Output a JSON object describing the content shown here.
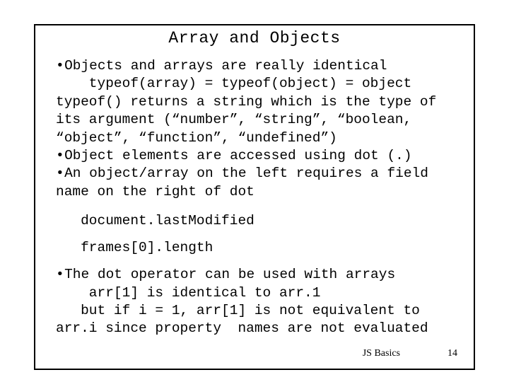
{
  "slide": {
    "title": "Array and Objects",
    "background_color": "#ffffff",
    "text_color": "#000000",
    "border_color": "#000000",
    "body": [
      {
        "kind": "bullet",
        "bullet": "•",
        "text": "Objects and arrays are really identical"
      },
      {
        "kind": "indent",
        "text": "    typeof(array) = typeof(object) = object"
      },
      {
        "kind": "plain",
        "text": "typeof() returns a string which is the type of"
      },
      {
        "kind": "plain",
        "text": "its argument (“number”, “string”, “boolean,"
      },
      {
        "kind": "plain",
        "text": "“object”, “function”, “undefined”)"
      },
      {
        "kind": "bullet",
        "bullet": "•",
        "text": "Object elements are accessed using dot (.)"
      },
      {
        "kind": "bullet",
        "bullet": "•",
        "text": "An object/array on the left requires a field"
      },
      {
        "kind": "plain",
        "text": "name on the right of dot"
      }
    ],
    "examples": [
      {
        "text": "   document.lastModified"
      },
      {
        "text": "   frames[0].length"
      }
    ],
    "body_after": [
      {
        "kind": "bullet",
        "bullet": "•",
        "text": "The dot operator can be used with arrays"
      },
      {
        "kind": "indent",
        "text": "    arr[1] is identical to arr.1"
      },
      {
        "kind": "indent",
        "text": "   but if i = 1, arr[1] is not equivalent to"
      },
      {
        "kind": "plain",
        "text": "arr.i since property  names are not evaluated"
      }
    ]
  },
  "footer": {
    "label": "JS Basics",
    "page_number": "14"
  }
}
